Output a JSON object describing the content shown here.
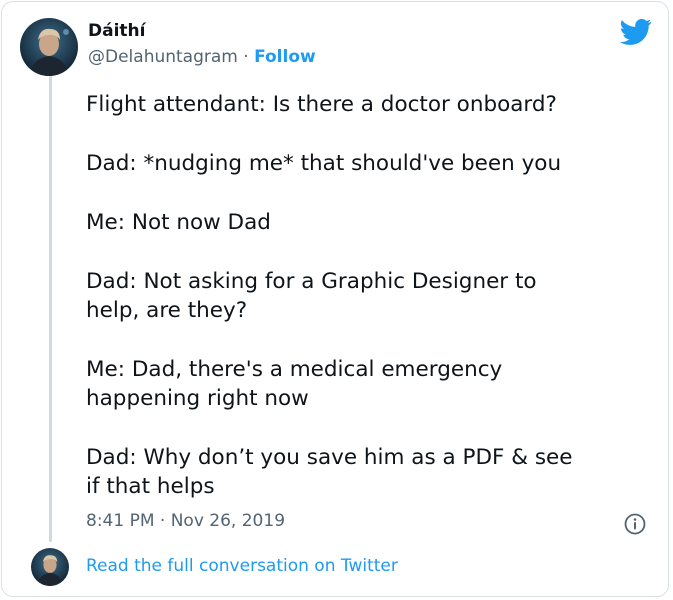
{
  "tweet": {
    "author": {
      "display_name": "Dáithí",
      "handle": "@Delahuntagram",
      "separator": "·",
      "follow_label": "Follow"
    },
    "paragraphs": [
      "Flight attendant: Is there a doctor onboard?",
      "Dad: *nudging me* that should've been you",
      "Me: Not now Dad",
      "Dad: Not asking for a Graphic Designer to\nhelp, are they?",
      "Me: Dad, there's a medical emergency\nhappening right now",
      "Dad: Why don’t you save him as a PDF & see\nif that helps"
    ],
    "time": "8:41 PM",
    "time_separator": "·",
    "date": "Nov 26, 2019",
    "read_full_label": "Read the full conversation on Twitter"
  },
  "icons": {
    "brand": "twitter-bird-icon",
    "info": "info-icon"
  },
  "colors": {
    "accent": "#1d9bf0",
    "text": "#0f1419",
    "secondary_text": "#536471",
    "border": "#d9e0e6"
  }
}
